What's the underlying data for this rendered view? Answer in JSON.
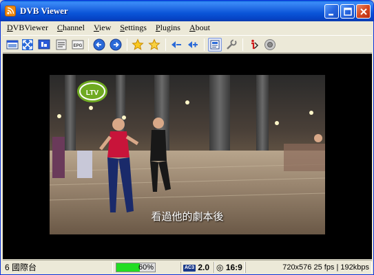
{
  "window": {
    "title": "DVB Viewer"
  },
  "menu": {
    "items": [
      {
        "label": "DVBViewer",
        "underline": "D",
        "rest": "VBViewer"
      },
      {
        "label": "Channel",
        "underline": "C",
        "rest": "hannel"
      },
      {
        "label": "View",
        "underline": "V",
        "rest": "iew"
      },
      {
        "label": "Settings",
        "underline": "S",
        "rest": "ettings"
      },
      {
        "label": "Plugins",
        "underline": "P",
        "rest": "lugins"
      },
      {
        "label": "About",
        "underline": "A",
        "rest": "bout"
      }
    ]
  },
  "toolbar": {
    "icons": [
      "window-icon",
      "fullscreen-icon",
      "desktop-icon",
      "teletext-icon",
      "epg-icon",
      "back-icon",
      "forward-icon",
      "favorite-icon",
      "favorite-add-icon",
      "volume-down-icon",
      "volume-up-icon",
      "osd-icon",
      "settings-icon",
      "info-icon",
      "record-icon"
    ],
    "epg_label": "EPG"
  },
  "video": {
    "subtitle": "看過他的劇本後",
    "channel_logo": "LTV"
  },
  "status": {
    "channel": "6 國際台",
    "signal_percent": 60,
    "signal_label": "60%",
    "audio_codec": "AC3",
    "audio_channels": "2.0",
    "aspect": "16:9",
    "video_info": "720x576 25 fps | 192kbps"
  },
  "colors": {
    "signal_bar": "#22dd22",
    "title_bar": "#0b55d8"
  }
}
